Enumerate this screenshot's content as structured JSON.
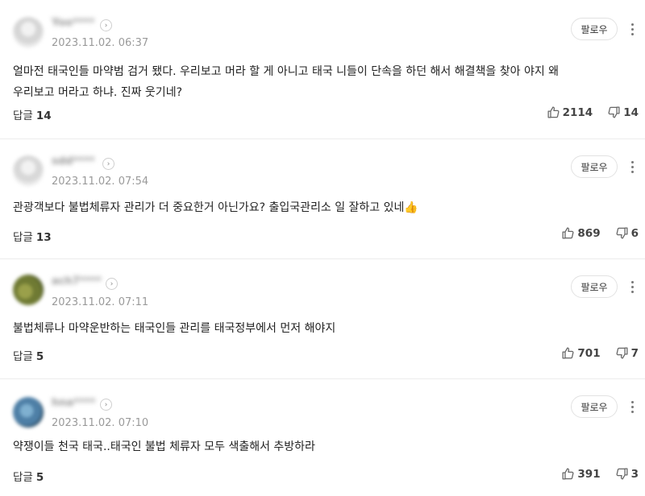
{
  "follow_label": "팔로우",
  "reply_label": "답글",
  "comments": [
    {
      "username": "Yoo****",
      "date": "2023.11.02. 06:37",
      "text_lines": [
        "얼마전 태국인들 마약범 검거 됐다. 우리보고 머라 할 게 아니고 태국 니들이 단속을 하던 해서 해결책을 찾아 야지 왜",
        "우리보고 머라고 하냐. 진짜 웃기네?"
      ],
      "replies": "14",
      "likes": "2114",
      "dislikes": "14",
      "avatar_colors": [
        "#e4e4e4",
        "#cfcfcf"
      ]
    },
    {
      "username": "sdd****",
      "date": "2023.11.02. 07:54",
      "text_lines": [
        "관광객보다 불법체류자 관리가 더 중요한거 아닌가요? 출입국관리소 일 잘하고 있네👍"
      ],
      "replies": "13",
      "likes": "869",
      "dislikes": "6",
      "avatar_colors": [
        "#e6e6e6",
        "#d2d2d2"
      ]
    },
    {
      "username": "ach7****",
      "date": "2023.11.02. 07:11",
      "text_lines": [
        "불법체류나 마약운반하는 태국인들 관리를 태국정부에서 먼저 해야지"
      ],
      "replies": "5",
      "likes": "701",
      "dislikes": "7",
      "avatar_colors": [
        "#8a8f3a",
        "#5e6b2a"
      ]
    },
    {
      "username": "hna****",
      "date": "2023.11.02. 07:10",
      "text_lines": [
        "약쟁이들 천국 태국..태국인 불법 체류자 모두 색출해서 추방하라"
      ],
      "replies": "5",
      "likes": "391",
      "dislikes": "3",
      "avatar_colors": [
        "#4e7fa6",
        "#2b4f6a"
      ]
    }
  ]
}
